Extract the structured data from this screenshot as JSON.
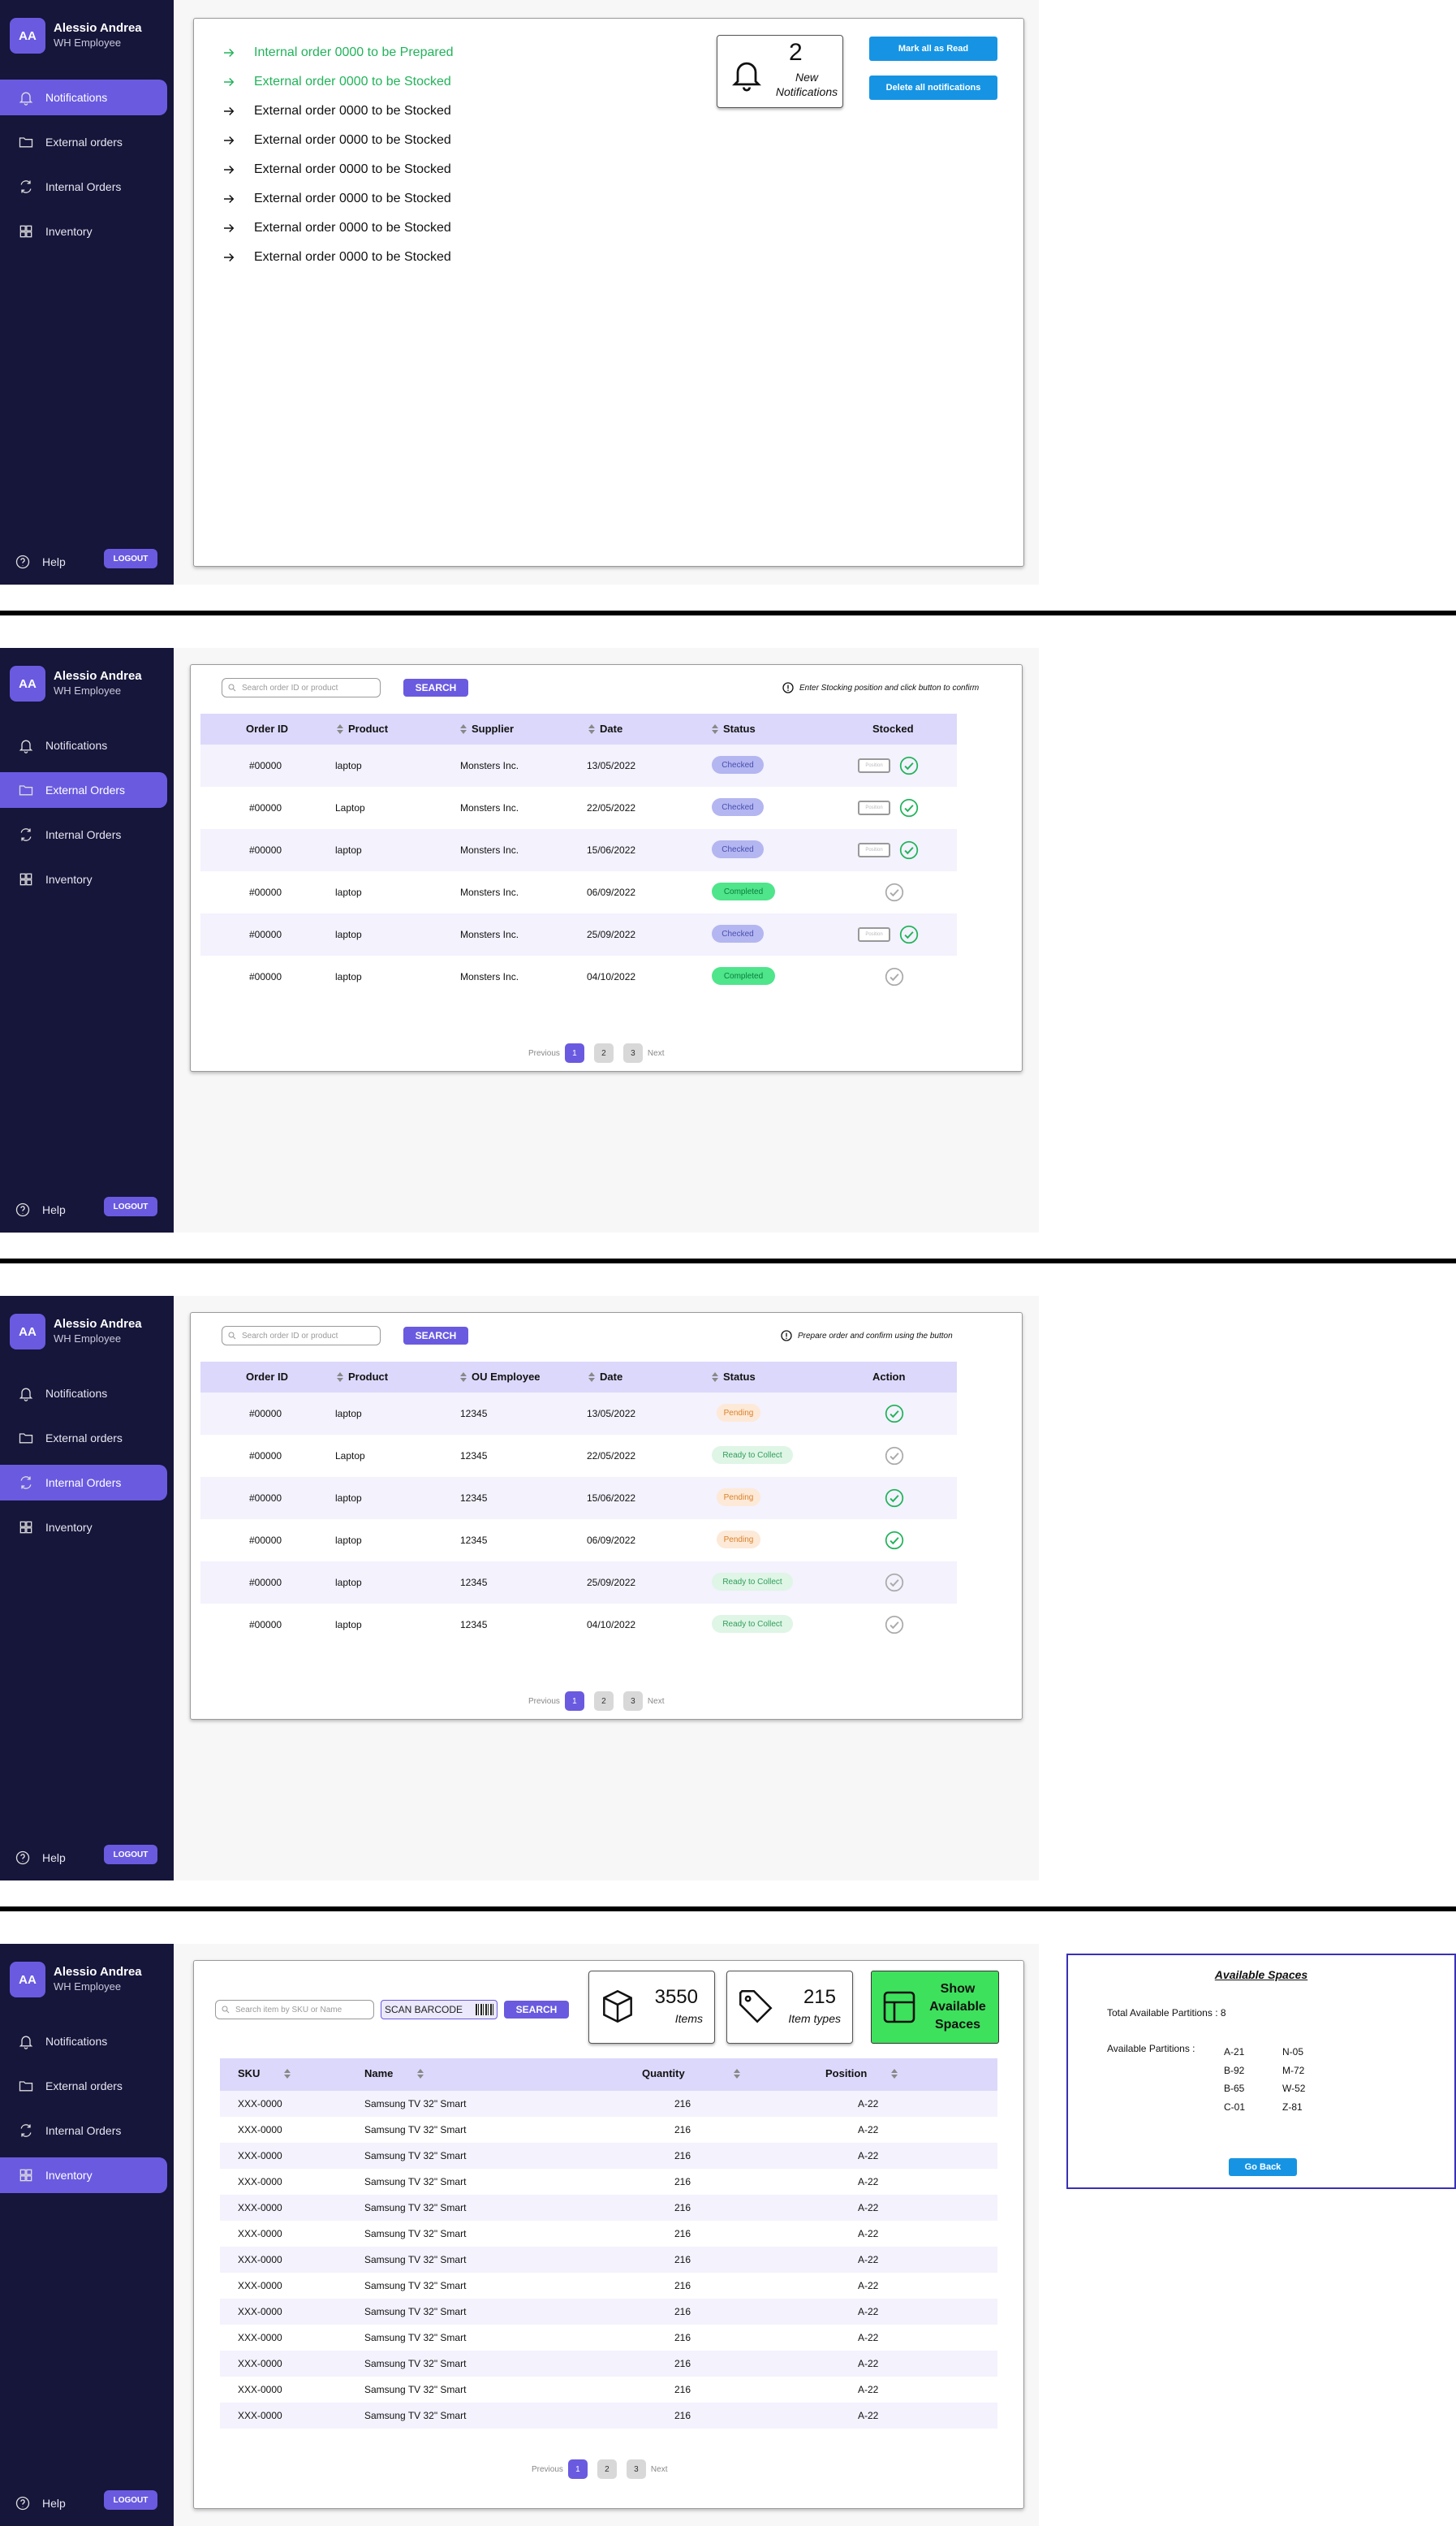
{
  "user": {
    "initials": "AA",
    "name": "Alessio Andrea",
    "role": "WH Employee"
  },
  "nav": {
    "notifications": "Notifications",
    "external_orders": "External orders",
    "external_orders_active": "External Orders",
    "internal_orders": "Internal Orders",
    "inventory": "Inventory",
    "help": "Help",
    "logout": "LOGOUT"
  },
  "notifications_screen": {
    "items": [
      {
        "text": "Internal order 0000 to be Prepared",
        "highlight": true
      },
      {
        "text": "External order 0000 to be Stocked",
        "highlight": true
      },
      {
        "text": "External order 0000 to be Stocked",
        "highlight": false
      },
      {
        "text": "External order 0000 to be Stocked",
        "highlight": false
      },
      {
        "text": "External order 0000 to be Stocked",
        "highlight": false
      },
      {
        "text": "External order 0000 to be Stocked",
        "highlight": false
      },
      {
        "text": "External order 0000 to be Stocked",
        "highlight": false
      },
      {
        "text": "External order 0000 to be Stocked",
        "highlight": false
      }
    ],
    "new_count": "2",
    "new_label": "New Notifications",
    "mark_all_read": "Mark all as Read",
    "delete_all": "Delete all notifications"
  },
  "external_screen": {
    "search_placeholder": "Search order ID or product",
    "search_button": "SEARCH",
    "hint": "Enter Stocking position and click button to confirm",
    "headers": [
      "Order ID",
      "Product",
      "Supplier",
      "Date",
      "Status",
      "Stocked"
    ],
    "rows": [
      {
        "id": "#00000",
        "product": "laptop",
        "supplier": "Monsters Inc.",
        "date": "13/05/2022",
        "status": "Checked"
      },
      {
        "id": "#00000",
        "product": "Laptop",
        "supplier": "Monsters Inc.",
        "date": "22/05/2022",
        "status": "Checked"
      },
      {
        "id": "#00000",
        "product": "laptop",
        "supplier": "Monsters Inc.",
        "date": "15/06/2022",
        "status": "Checked"
      },
      {
        "id": "#00000",
        "product": "laptop",
        "supplier": "Monsters Inc.",
        "date": "06/09/2022",
        "status": "Completed"
      },
      {
        "id": "#00000",
        "product": "laptop",
        "supplier": "Monsters Inc.",
        "date": "25/09/2022",
        "status": "Checked"
      },
      {
        "id": "#00000",
        "product": "laptop",
        "supplier": "Monsters Inc.",
        "date": "04/10/2022",
        "status": "Completed"
      }
    ],
    "position_placeholder": "Position"
  },
  "internal_screen": {
    "search_placeholder": "Search order ID or product",
    "search_button": "SEARCH",
    "hint": "Prepare order and confirm using the button",
    "headers": [
      "Order ID",
      "Product",
      "OU Employee",
      "Date",
      "Status",
      "Action"
    ],
    "rows": [
      {
        "id": "#00000",
        "product": "laptop",
        "employee": "12345",
        "date": "13/05/2022",
        "status": "Pending"
      },
      {
        "id": "#00000",
        "product": "Laptop",
        "employee": "12345",
        "date": "22/05/2022",
        "status": "Ready to Collect"
      },
      {
        "id": "#00000",
        "product": "laptop",
        "employee": "12345",
        "date": "15/06/2022",
        "status": "Pending"
      },
      {
        "id": "#00000",
        "product": "laptop",
        "employee": "12345",
        "date": "06/09/2022",
        "status": "Pending"
      },
      {
        "id": "#00000",
        "product": "laptop",
        "employee": "12345",
        "date": "25/09/2022",
        "status": "Ready to Collect"
      },
      {
        "id": "#00000",
        "product": "laptop",
        "employee": "12345",
        "date": "04/10/2022",
        "status": "Ready to Collect"
      }
    ]
  },
  "pager": {
    "previous": "Previous",
    "next": "Next",
    "pages": [
      "1",
      "2",
      "3"
    ]
  },
  "inventory_screen": {
    "search_placeholder": "Search item by SKU or Name",
    "scan_button": "SCAN BARCODE",
    "search_button": "SEARCH",
    "items_count": "3550",
    "items_label": "Items",
    "types_count": "215",
    "types_label": "Item types",
    "show_spaces": "Show Available Spaces",
    "headers": [
      "SKU",
      "Name",
      "Quantity",
      "Position"
    ],
    "row": {
      "sku": "XXX-0000",
      "name": "Samsung TV 32\" Smart",
      "qty": "216",
      "pos": "A-22"
    },
    "row_count": 13
  },
  "spaces_popup": {
    "title": "Available Spaces",
    "total": "Total Available Partitions : 8",
    "available_label": "Available Partitions :",
    "col1": [
      "A-21",
      "B-92",
      "B-65",
      "C-01"
    ],
    "col2": [
      "N-05",
      "M-72",
      "W-52",
      "Z-81"
    ],
    "go_back": "Go Back"
  },
  "colors": {
    "sidebar": "#16153a",
    "accent": "#6a5ae0",
    "blue": "#1694e3",
    "green": "#21b35a"
  }
}
